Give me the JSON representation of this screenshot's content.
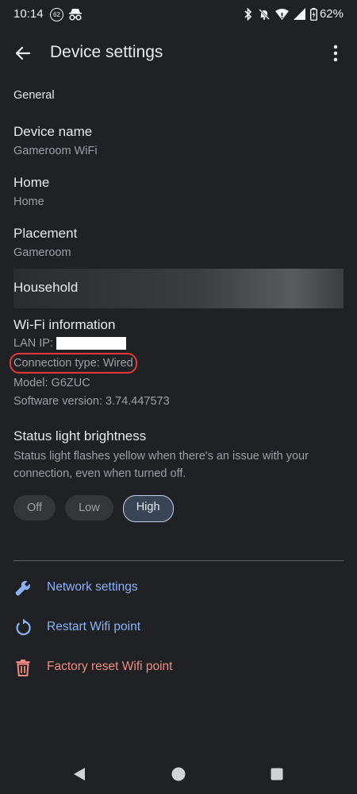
{
  "status_bar": {
    "time": "10:14",
    "notification_count": "62",
    "battery": "62%"
  },
  "app_bar": {
    "title": "Device settings"
  },
  "section": {
    "general": "General"
  },
  "settings": {
    "device_name": {
      "title": "Device name",
      "value": "Gameroom WiFi"
    },
    "home": {
      "title": "Home",
      "value": "Home"
    },
    "placement": {
      "title": "Placement",
      "value": "Gameroom"
    },
    "household": {
      "title": "Household"
    }
  },
  "wifi_info": {
    "title": "Wi-Fi information",
    "lan_ip_label": "LAN IP:",
    "connection_type": "Connection type: Wired",
    "model": "Model: G6ZUC",
    "software_version": "Software version: 3.74.447573"
  },
  "status_light": {
    "title": "Status light brightness",
    "description": "Status light flashes yellow when there's an issue with your connection, even when turned off.",
    "options": [
      "Off",
      "Low",
      "High"
    ],
    "selected": "High"
  },
  "actions": {
    "network_settings": "Network settings",
    "restart": "Restart Wifi point",
    "factory_reset": "Factory reset Wifi point"
  },
  "colors": {
    "background": "#202124",
    "accent_blue": "#8ab4f8",
    "danger_red": "#f28b82",
    "highlight_red": "#e53935"
  }
}
